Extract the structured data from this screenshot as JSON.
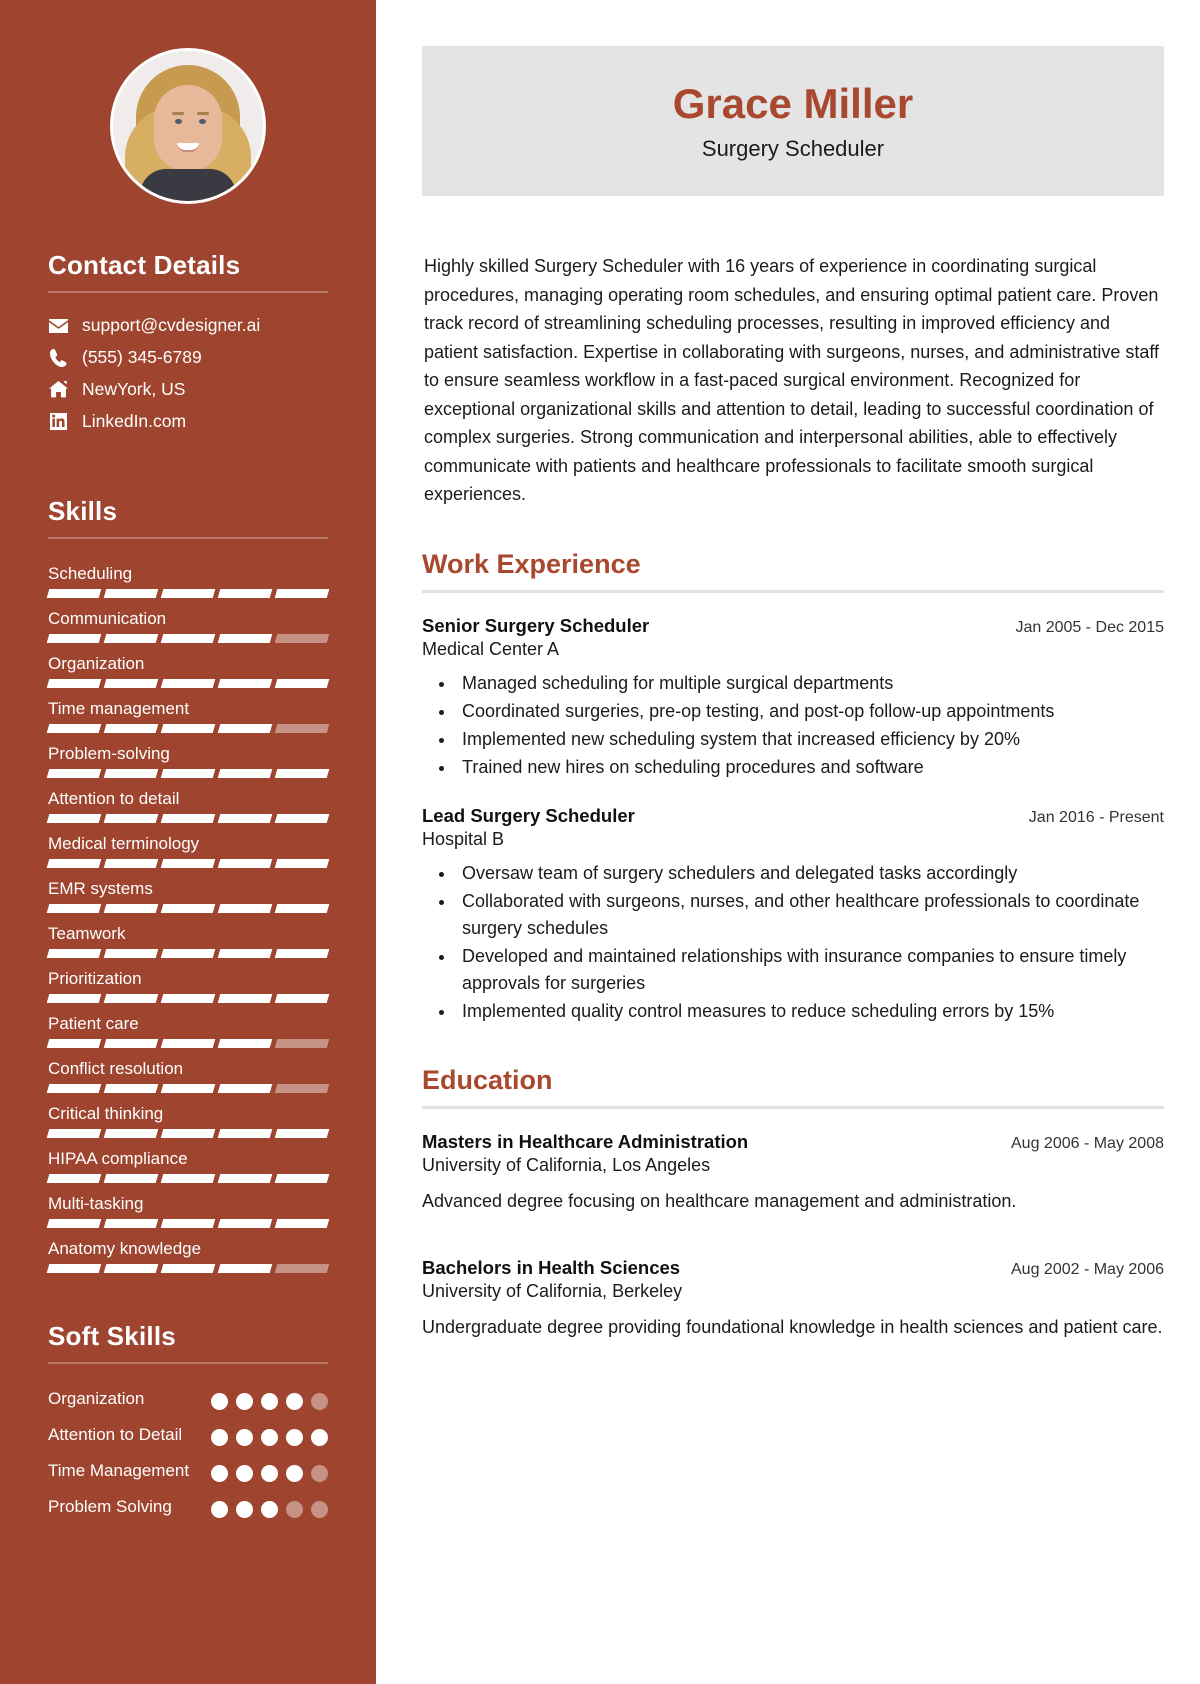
{
  "accent": {
    "sidebar_bg": "#9e442f",
    "heading_color": "#a8482f",
    "name_card_bg": "#e4e4e4"
  },
  "sidebar": {
    "avatar_alt": "profile-photo",
    "contact": {
      "heading": "Contact Details",
      "items": [
        {
          "icon": "email-icon",
          "value": "support@cvdesigner.ai"
        },
        {
          "icon": "phone-icon",
          "value": "(555) 345-6789"
        },
        {
          "icon": "home-icon",
          "value": "NewYork, US"
        },
        {
          "icon": "linkedin-icon",
          "value": "LinkedIn.com"
        }
      ]
    },
    "skills": {
      "heading": "Skills",
      "max": 5,
      "items": [
        {
          "label": "Scheduling",
          "level": 5
        },
        {
          "label": "Communication",
          "level": 4
        },
        {
          "label": "Organization",
          "level": 5
        },
        {
          "label": "Time management",
          "level": 4
        },
        {
          "label": "Problem-solving",
          "level": 5
        },
        {
          "label": "Attention to detail",
          "level": 5
        },
        {
          "label": "Medical terminology",
          "level": 5
        },
        {
          "label": "EMR systems",
          "level": 5
        },
        {
          "label": "Teamwork",
          "level": 5
        },
        {
          "label": "Prioritization",
          "level": 5
        },
        {
          "label": "Patient care",
          "level": 4
        },
        {
          "label": "Conflict resolution",
          "level": 4
        },
        {
          "label": "Critical thinking",
          "level": 5
        },
        {
          "label": "HIPAA compliance",
          "level": 5
        },
        {
          "label": "Multi-tasking",
          "level": 5
        },
        {
          "label": "Anatomy knowledge",
          "level": 4
        }
      ]
    },
    "soft_skills": {
      "heading": "Soft Skills",
      "max": 5,
      "items": [
        {
          "label": "Organization",
          "level": 4
        },
        {
          "label": "Attention to Detail",
          "level": 5
        },
        {
          "label": "Time Management",
          "level": 4
        },
        {
          "label": "Problem Solving",
          "level": 3
        }
      ]
    }
  },
  "header": {
    "name": "Grace Miller",
    "role": "Surgery Scheduler"
  },
  "summary": "Highly skilled Surgery Scheduler with 16 years of experience in coordinating surgical procedures, managing operating room schedules, and ensuring optimal patient care. Proven track record of streamlining scheduling processes, resulting in improved efficiency and patient satisfaction. Expertise in collaborating with surgeons, nurses, and administrative staff to ensure seamless workflow in a fast-paced surgical environment. Recognized for exceptional organizational skills and attention to detail, leading to successful coordination of complex surgeries. Strong communication and interpersonal abilities, able to effectively communicate with patients and healthcare professionals to facilitate smooth surgical experiences.",
  "work": {
    "heading": "Work Experience",
    "entries": [
      {
        "title": "Senior Surgery Scheduler",
        "org": "Medical Center A",
        "date": "Jan 2005 - Dec 2015",
        "bullets": [
          "Managed scheduling for multiple surgical departments",
          "Coordinated surgeries, pre-op testing, and post-op follow-up appointments",
          "Implemented new scheduling system that increased efficiency by 20%",
          "Trained new hires on scheduling procedures and software"
        ]
      },
      {
        "title": "Lead Surgery Scheduler",
        "org": "Hospital B",
        "date": "Jan 2016 - Present",
        "bullets": [
          "Oversaw team of surgery schedulers and delegated tasks accordingly",
          "Collaborated with surgeons, nurses, and other healthcare professionals to coordinate surgery schedules",
          "Developed and maintained relationships with insurance companies to ensure timely approvals for surgeries",
          "Implemented quality control measures to reduce scheduling errors by 15%"
        ]
      }
    ]
  },
  "education": {
    "heading": "Education",
    "entries": [
      {
        "title": "Masters in Healthcare Administration",
        "org": "University of California, Los Angeles",
        "date": "Aug 2006 - May 2008",
        "desc": "Advanced degree focusing on healthcare management and administration."
      },
      {
        "title": "Bachelors in Health Sciences",
        "org": "University of California, Berkeley",
        "date": "Aug 2002 - May 2006",
        "desc": "Undergraduate degree providing foundational knowledge in health sciences and patient care."
      }
    ]
  }
}
